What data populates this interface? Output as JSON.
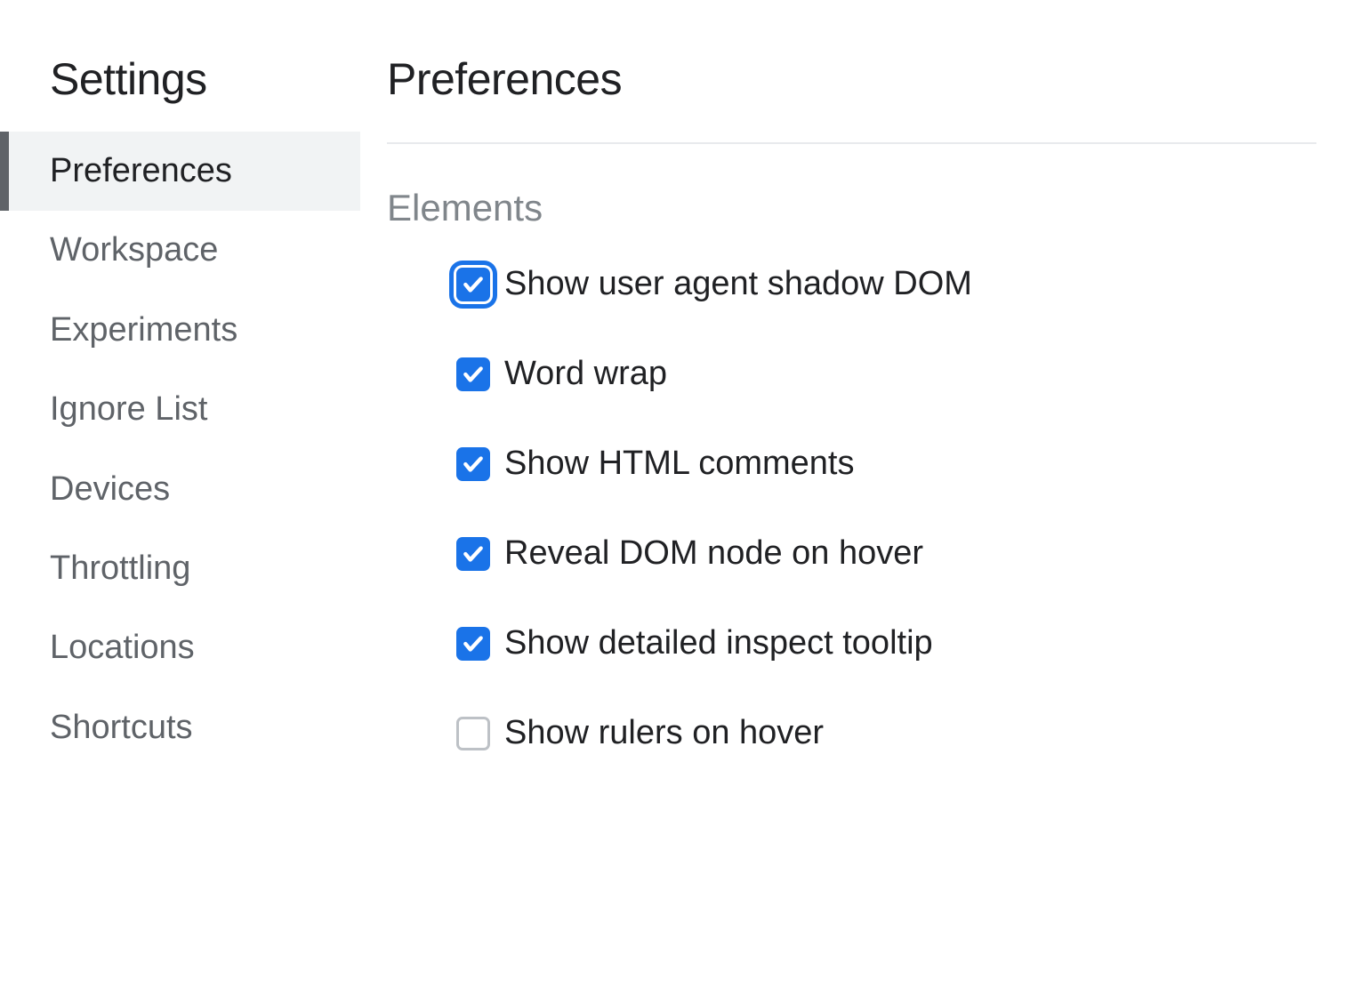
{
  "sidebar": {
    "title": "Settings",
    "items": [
      {
        "label": "Preferences",
        "selected": true
      },
      {
        "label": "Workspace",
        "selected": false
      },
      {
        "label": "Experiments",
        "selected": false
      },
      {
        "label": "Ignore List",
        "selected": false
      },
      {
        "label": "Devices",
        "selected": false
      },
      {
        "label": "Throttling",
        "selected": false
      },
      {
        "label": "Locations",
        "selected": false
      },
      {
        "label": "Shortcuts",
        "selected": false
      }
    ]
  },
  "main": {
    "title": "Preferences",
    "section": "Elements",
    "options": [
      {
        "label": "Show user agent shadow DOM",
        "checked": true,
        "focused": true
      },
      {
        "label": "Word wrap",
        "checked": true,
        "focused": false
      },
      {
        "label": "Show HTML comments",
        "checked": true,
        "focused": false
      },
      {
        "label": "Reveal DOM node on hover",
        "checked": true,
        "focused": false
      },
      {
        "label": "Show detailed inspect tooltip",
        "checked": true,
        "focused": false
      },
      {
        "label": "Show rulers on hover",
        "checked": false,
        "focused": false
      }
    ]
  }
}
